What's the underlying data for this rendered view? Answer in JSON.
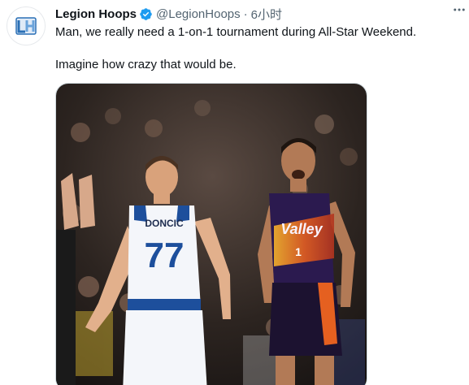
{
  "tweet": {
    "display_name": "Legion Hoops",
    "handle": "@LegionHoops",
    "separator": "·",
    "time": "6小时",
    "text_line_1": "Man, we really need a 1-on-1 tournament during All-Star Weekend.",
    "text_line_2": "Imagine how crazy that would be."
  },
  "icons": {
    "verified": "verified-badge-icon",
    "more": "more-options-icon",
    "avatar": "legion-hoops-logo"
  },
  "colors": {
    "verified_blue": "#1d9bf0",
    "secondary_text": "#536471",
    "mavs_blue": "#1d4f9c",
    "suns_purple": "#2b1a4f",
    "suns_orange": "#e56020"
  },
  "media": {
    "left_player_name": "DONCIC",
    "left_player_number": "77",
    "right_player_team": "Valley",
    "right_player_number": "1"
  }
}
